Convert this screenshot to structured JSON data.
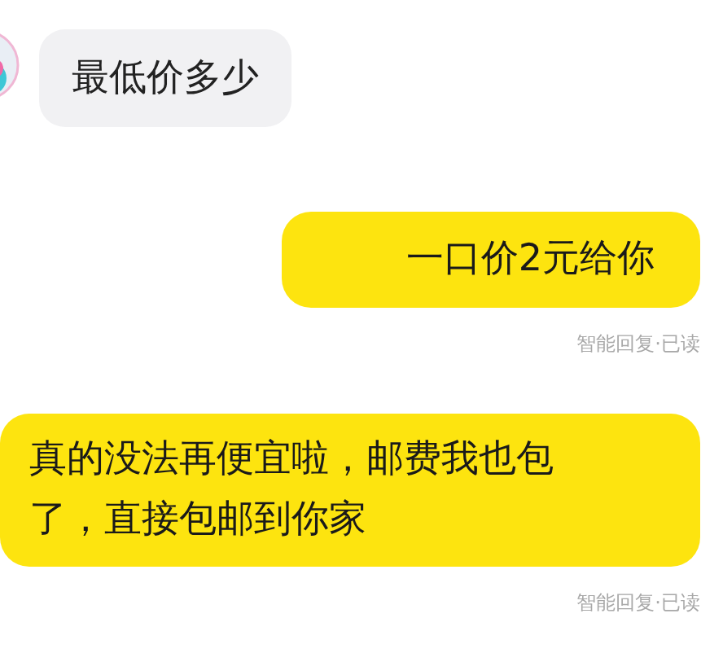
{
  "messages": [
    {
      "kind": "incoming",
      "text": "最低价多少"
    },
    {
      "kind": "outgoing",
      "text": "一口价2元给你",
      "status": "智能回复·已读"
    },
    {
      "kind": "outgoing",
      "text": "真的没法再便宜啦，邮费我也包了，直接包邮到你家",
      "status": "智能回复·已读"
    }
  ]
}
